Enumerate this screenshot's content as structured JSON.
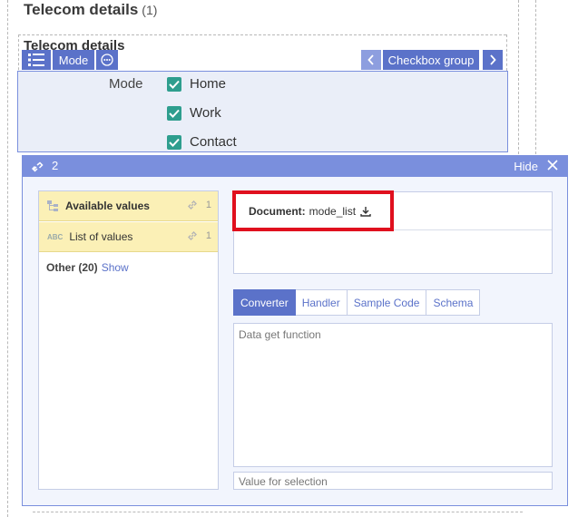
{
  "section": {
    "title": "Telecom details",
    "count": "(1)"
  },
  "group": {
    "title": "Telecom details"
  },
  "toolbar": {
    "mode_label": "Mode",
    "widget_label": "Checkbox group",
    "icons": [
      "list-icon",
      "more-icon",
      "chevron-left-icon",
      "chevron-right-icon"
    ]
  },
  "mode_field": {
    "label": "Mode",
    "options": [
      {
        "label": "Home",
        "checked": true
      },
      {
        "label": "Work",
        "checked": true
      },
      {
        "label": "Contact",
        "checked": true
      }
    ]
  },
  "panel": {
    "link_count": "2",
    "hide_label": "Hide",
    "accent": "#7a8fdd",
    "left_list": {
      "items": [
        {
          "label": "Available values",
          "count": "1",
          "bold": true
        },
        {
          "label": "List of values",
          "count": "1",
          "bold": false,
          "badge": "ABC"
        }
      ],
      "other_label": "Other (20)",
      "show_label": "Show"
    },
    "document": {
      "label": "Document:",
      "value": "mode_list"
    },
    "tabs": [
      {
        "label": "Converter",
        "active": true
      },
      {
        "label": "Handler",
        "active": false
      },
      {
        "label": "Sample Code",
        "active": false
      },
      {
        "label": "Schema",
        "active": false
      }
    ],
    "code_placeholder": "Data get function",
    "value_placeholder": "Value for selection"
  }
}
